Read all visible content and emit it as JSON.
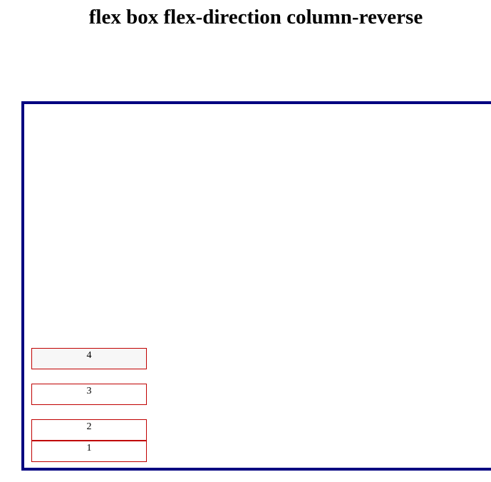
{
  "page": {
    "title": "flex box flex-direction column-reverse"
  },
  "flex": {
    "items": [
      {
        "label": "1"
      },
      {
        "label": "2"
      },
      {
        "label": "3"
      },
      {
        "label": "4"
      }
    ]
  },
  "colors": {
    "container_border": "#000080",
    "item_border": "#c00000"
  }
}
